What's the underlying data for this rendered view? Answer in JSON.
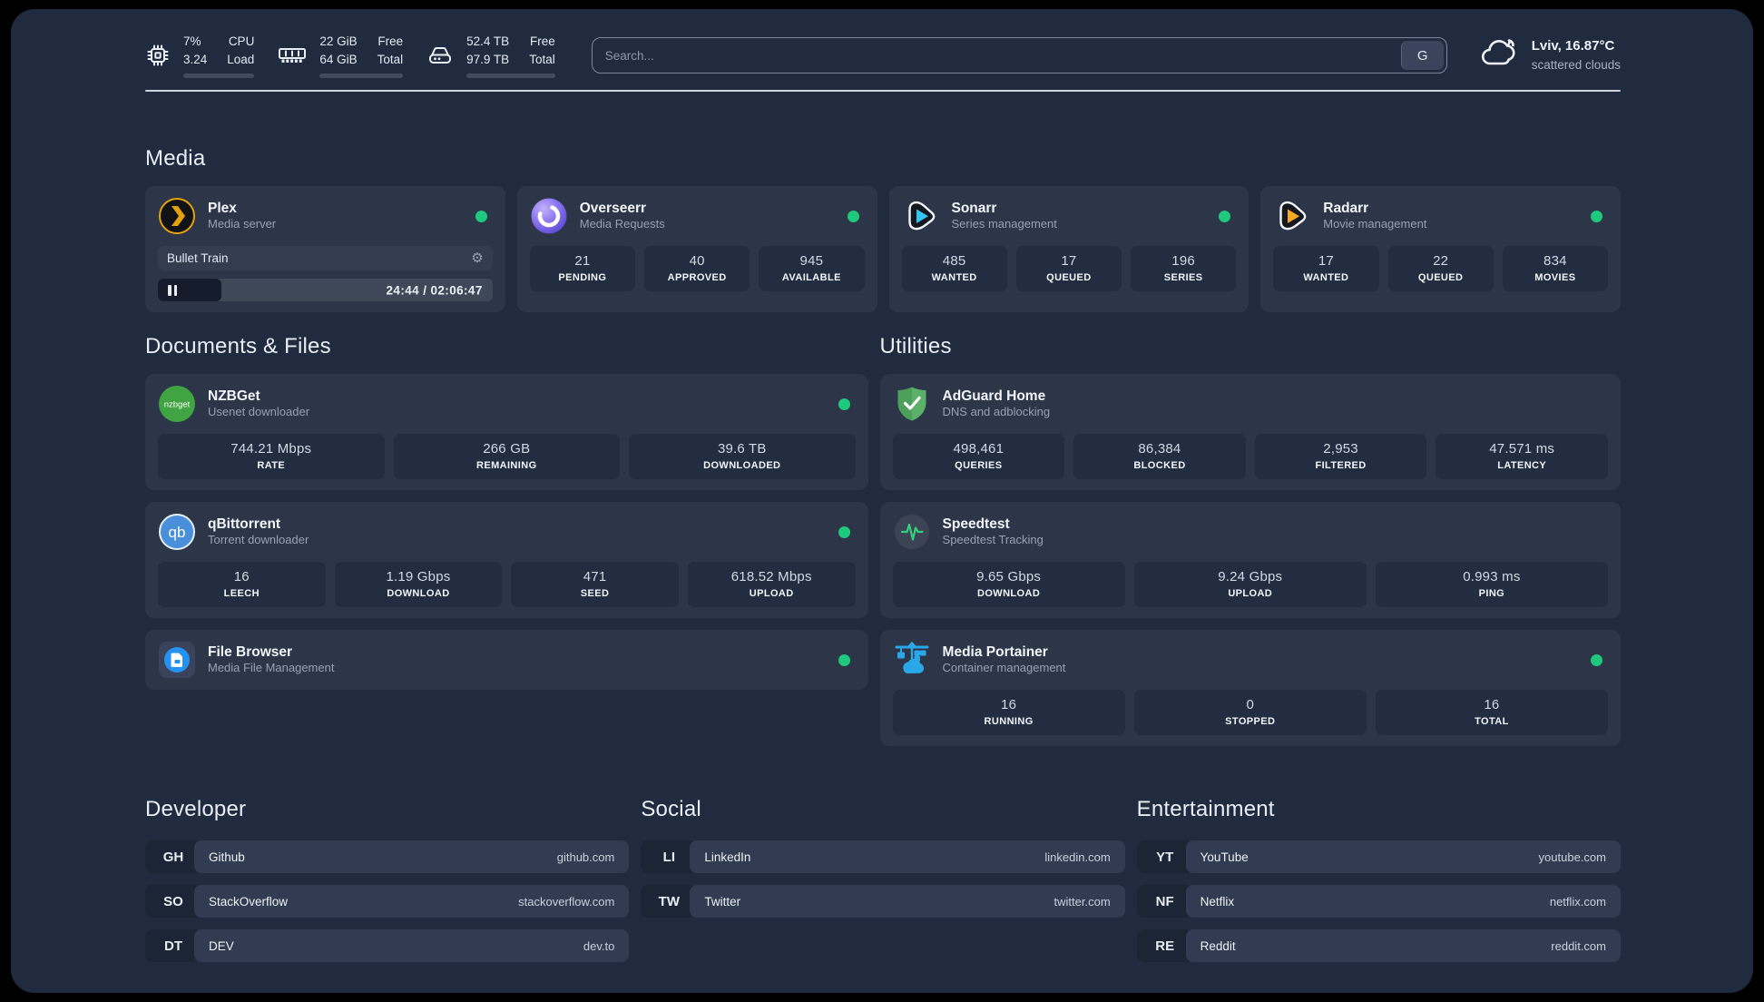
{
  "colors": {
    "accent-green": "#1ec97d",
    "plex-amber": "#e5a00d",
    "overseerr-purple": "#8570ec",
    "sonarr-cyan": "#35c5f4",
    "radarr-amber": "#f7a823",
    "nzbget-green": "#3fa441",
    "qbittorrent-blue": "#4a8fd9",
    "filebrowser-blue": "#2492f0",
    "adguard-green": "#5cb168",
    "speedtest-green": "#2fd180",
    "portainer-blue": "#2aa7e8"
  },
  "topbar": {
    "cpu": {
      "icon": "cpu-icon",
      "value_top": "7%",
      "value_bottom": "3.24",
      "label_top": "CPU",
      "label_bottom": "Load",
      "used_percent": 7
    },
    "ram": {
      "icon": "ram-icon",
      "value_top": "22 GiB",
      "value_bottom": "64 GiB",
      "label_top": "Free",
      "label_bottom": "Total",
      "used_percent": 66
    },
    "disk": {
      "icon": "disk-icon",
      "value_top": "52.4 TB",
      "value_bottom": "97.9 TB",
      "label_top": "Free",
      "label_bottom": "Total",
      "used_percent": 46
    },
    "search": {
      "placeholder": "Search...",
      "button_label": "G"
    },
    "weather": {
      "icon": "cloud-icon",
      "location": "Lviv, 16.87°C",
      "condition": "scattered clouds"
    }
  },
  "sections": {
    "media": {
      "title": "Media",
      "services": [
        {
          "icon": "plex-icon",
          "name": "Plex",
          "desc": "Media server",
          "online": true,
          "player": {
            "title": "Bullet Train",
            "time": "24:44 / 02:06:47",
            "progress": 19
          }
        },
        {
          "icon": "overseerr-icon",
          "name": "Overseerr",
          "desc": "Media Requests",
          "online": true,
          "stats": [
            {
              "value": "21",
              "label": "PENDING"
            },
            {
              "value": "40",
              "label": "APPROVED"
            },
            {
              "value": "945",
              "label": "AVAILABLE"
            }
          ]
        },
        {
          "icon": "sonarr-icon",
          "name": "Sonarr",
          "desc": "Series management",
          "online": true,
          "stats": [
            {
              "value": "485",
              "label": "WANTED"
            },
            {
              "value": "17",
              "label": "QUEUED"
            },
            {
              "value": "196",
              "label": "SERIES"
            }
          ]
        },
        {
          "icon": "radarr-icon",
          "name": "Radarr",
          "desc": "Movie management",
          "online": true,
          "stats": [
            {
              "value": "17",
              "label": "WANTED"
            },
            {
              "value": "22",
              "label": "QUEUED"
            },
            {
              "value": "834",
              "label": "MOVIES"
            }
          ]
        }
      ]
    },
    "documents": {
      "title": "Documents & Files",
      "services": [
        {
          "icon": "nzbget-icon",
          "name": "NZBGet",
          "desc": "Usenet downloader",
          "online": true,
          "stats": [
            {
              "value": "744.21 Mbps",
              "label": "RATE"
            },
            {
              "value": "266 GB",
              "label": "REMAINING"
            },
            {
              "value": "39.6 TB",
              "label": "DOWNLOADED"
            }
          ]
        },
        {
          "icon": "qbittorrent-icon",
          "name": "qBittorrent",
          "desc": "Torrent downloader",
          "online": true,
          "stats": [
            {
              "value": "16",
              "label": "LEECH"
            },
            {
              "value": "1.19 Gbps",
              "label": "DOWNLOAD"
            },
            {
              "value": "471",
              "label": "SEED"
            },
            {
              "value": "618.52 Mbps",
              "label": "UPLOAD"
            }
          ]
        },
        {
          "icon": "filebrowser-icon",
          "name": "File Browser",
          "desc": "Media File Management",
          "online": true,
          "stats": []
        }
      ]
    },
    "utilities": {
      "title": "Utilities",
      "services": [
        {
          "icon": "adguard-icon",
          "name": "AdGuard Home",
          "desc": "DNS and adblocking",
          "online": false,
          "stats": [
            {
              "value": "498,461",
              "label": "QUERIES"
            },
            {
              "value": "86,384",
              "label": "BLOCKED"
            },
            {
              "value": "2,953",
              "label": "FILTERED"
            },
            {
              "value": "47.571 ms",
              "label": "LATENCY"
            }
          ]
        },
        {
          "icon": "speedtest-icon",
          "name": "Speedtest",
          "desc": "Speedtest Tracking",
          "online": false,
          "stats": [
            {
              "value": "9.65 Gbps",
              "label": "DOWNLOAD"
            },
            {
              "value": "9.24 Gbps",
              "label": "UPLOAD"
            },
            {
              "value": "0.993 ms",
              "label": "PING"
            }
          ]
        },
        {
          "icon": "portainer-icon",
          "name": "Media Portainer",
          "desc": "Container management",
          "online": true,
          "stats": [
            {
              "value": "16",
              "label": "RUNNING"
            },
            {
              "value": "0",
              "label": "STOPPED"
            },
            {
              "value": "16",
              "label": "TOTAL"
            }
          ]
        }
      ]
    },
    "bookmarks": [
      {
        "title": "Developer",
        "items": [
          {
            "abbr": "GH",
            "name": "Github",
            "url": "github.com"
          },
          {
            "abbr": "SO",
            "name": "StackOverflow",
            "url": "stackoverflow.com"
          },
          {
            "abbr": "DT",
            "name": "DEV",
            "url": "dev.to"
          }
        ]
      },
      {
        "title": "Social",
        "items": [
          {
            "abbr": "LI",
            "name": "LinkedIn",
            "url": "linkedin.com"
          },
          {
            "abbr": "TW",
            "name": "Twitter",
            "url": "twitter.com"
          }
        ]
      },
      {
        "title": "Entertainment",
        "items": [
          {
            "abbr": "YT",
            "name": "YouTube",
            "url": "youtube.com"
          },
          {
            "abbr": "NF",
            "name": "Netflix",
            "url": "netflix.com"
          },
          {
            "abbr": "RE",
            "name": "Reddit",
            "url": "reddit.com"
          }
        ]
      }
    ]
  }
}
